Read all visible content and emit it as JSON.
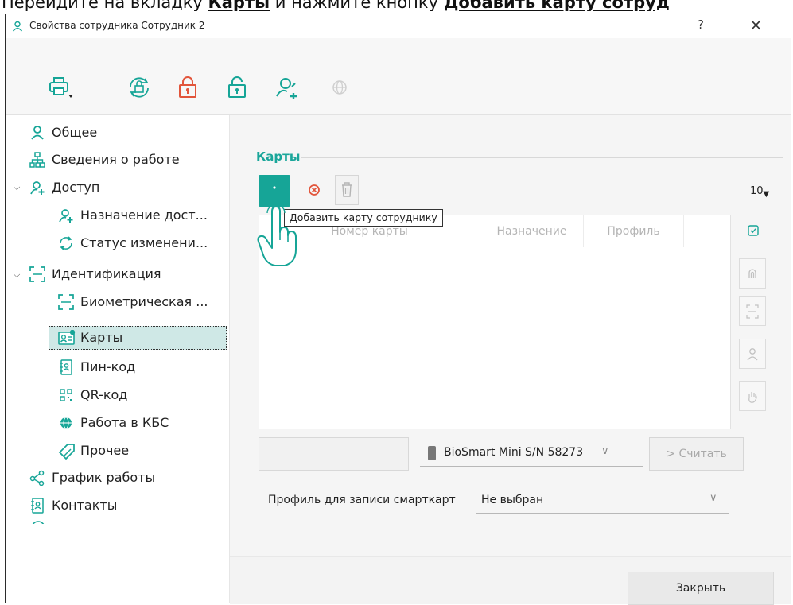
{
  "doc_caption": {
    "text": "Перейдите на вкладку ",
    "b1": "Карты",
    "mid": " и нажмите кнопку ",
    "b2": "Добавить карту сотруд"
  },
  "window": {
    "title": "Свойства сотрудника Сотрудник 2",
    "help": "?",
    "close": "×"
  },
  "toolbar": {
    "icons": [
      "printer-icon",
      "rotate-lock-icon",
      "lock-red-icon",
      "unlock-icon",
      "add-user-icon",
      "globe-icon"
    ]
  },
  "sidebar": {
    "items": [
      {
        "label": "Общее"
      },
      {
        "label": "Сведения о работе"
      },
      {
        "label": "Доступ"
      },
      {
        "label": "Назначение дост..."
      },
      {
        "label": "Статус изменени..."
      },
      {
        "label": "Идентификация"
      },
      {
        "label": "Биометрическая ..."
      },
      {
        "label": "Карты"
      },
      {
        "label": "Пин-код"
      },
      {
        "label": "QR-код"
      },
      {
        "label": "Работа в КБС"
      },
      {
        "label": "Прочее"
      },
      {
        "label": "График работы"
      },
      {
        "label": "Контакты"
      }
    ],
    "selected": "Карты"
  },
  "main": {
    "group_title": "Карты",
    "page_size": "10",
    "tooltip": "Добавить карту сотруднику",
    "table": {
      "columns": [
        "Номер карты",
        "Назначение",
        "Профиль"
      ]
    },
    "device": "BioSmart Mini S/N 58273",
    "read_button": "> Считать",
    "profile_label": "Профиль для записи смарткарт",
    "profile_value": "Не выбран",
    "close_button": "Закрыть"
  },
  "colors": {
    "accent": "#16a597",
    "accent_text": "#1aa69a",
    "selection_bg": "#cfe8e6",
    "lock_red": "#e2553b"
  }
}
